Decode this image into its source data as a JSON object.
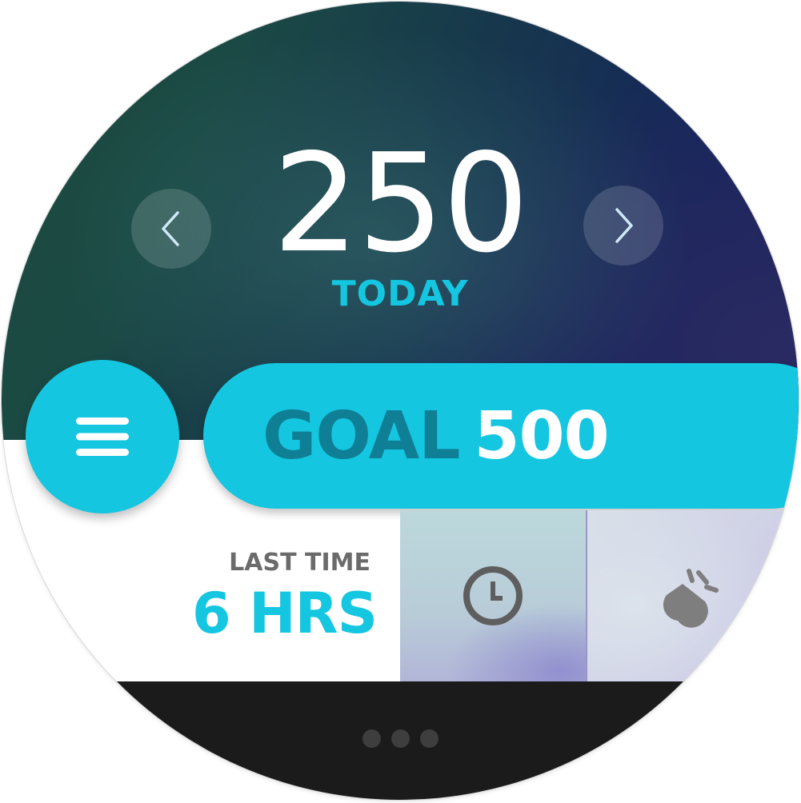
{
  "counter": {
    "value": "250",
    "period_label": "TODAY"
  },
  "navigation": {
    "prev_icon": "chevron-left-icon",
    "next_icon": "chevron-right-icon"
  },
  "goal": {
    "label": "GOAL",
    "value": "500"
  },
  "menu": {
    "icon": "hamburger-menu-icon"
  },
  "last_time": {
    "label": "LAST TIME",
    "value": "6 HRS"
  },
  "tiles": [
    {
      "icon": "clock-icon"
    },
    {
      "icon": "tap-icon"
    }
  ],
  "pager": {
    "dots": 3
  },
  "colors": {
    "accent": "#14c6e0",
    "goal_label": "#0f7f95",
    "bottom_bar": "#1b1b1b"
  }
}
